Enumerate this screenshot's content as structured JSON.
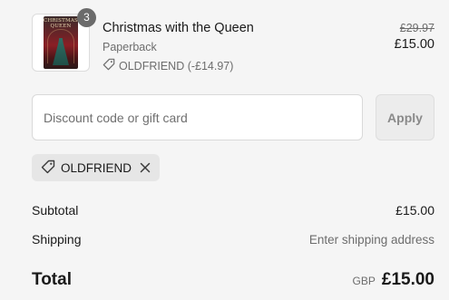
{
  "item": {
    "quantity": "3",
    "title": "Christmas with the Queen",
    "format": "Paperback",
    "discount_label": "OLDFRIEND (-£14.97)",
    "original_price": "£29.97",
    "price": "£15.00",
    "cover_text": "CHRISTMAS QUEEN"
  },
  "discount": {
    "placeholder": "Discount code or gift card",
    "apply_label": "Apply",
    "applied_code": "OLDFRIEND"
  },
  "summary": {
    "subtotal_label": "Subtotal",
    "subtotal_value": "£15.00",
    "shipping_label": "Shipping",
    "shipping_value": "Enter shipping address",
    "total_label": "Total",
    "currency": "GBP",
    "total_value": "£15.00"
  },
  "colors": {
    "background": "#f5f5f5",
    "badge": "#6b6b6b",
    "muted_text": "#6d6d6d",
    "chip_background": "#e6e6e6"
  },
  "icons": {
    "discount_tag": "tag-icon",
    "remove": "close-icon"
  }
}
